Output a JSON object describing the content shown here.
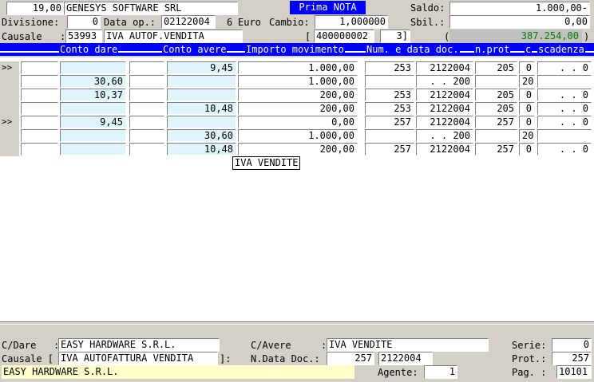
{
  "header": {
    "amount": "19,00",
    "company": "GENESYS SOFTWARE SRL",
    "title": "Prima NOTA",
    "saldo_label": "Saldo:",
    "saldo_value": "1.000,00-",
    "sbil_label": "Sbil.:",
    "sbil_value": "0,00",
    "divisione_label": "Divisione:",
    "divisione_value": "0",
    "data_op_label": "Data op.:",
    "data_op_value": "02122004",
    "data_op_extra": "6",
    "euro_label": "Euro",
    "cambio_label": "Cambio:",
    "cambio_value": "1,000000",
    "causale_label": "Causale",
    "causale_code": "53993",
    "causale_desc": "IVA AUTOF.VENDITA",
    "bracket_open": "[",
    "registro_value": "400000002",
    "registro_num": "3]",
    "paren_open": "(",
    "totale_value": "387.254,00",
    "paren_close": ")"
  },
  "columns": {
    "conto_dare": "Conto dare",
    "conto_avere": "Conto avere",
    "importo": "Importo movimento",
    "num_data": "Num. e data doc.",
    "n_prot": "n.prot",
    "c": "c",
    "scadenza": "scadenza"
  },
  "rows": [
    {
      "mark": ">>",
      "dare": "",
      "avere": "9,45",
      "importo": "1.000,00",
      "num": "253",
      "data": "2122004",
      "prot": "205",
      "c": "0",
      "scad": ". . 0"
    },
    {
      "mark": "",
      "dare": "30,60",
      "avere": "",
      "importo": "1.000,00",
      "num": "",
      "data": ". . 200",
      "prot": "",
      "c": "20",
      "scad": ""
    },
    {
      "mark": "",
      "dare": "10,37",
      "avere": "",
      "importo": "200,00",
      "num": "253",
      "data": "2122004",
      "prot": "205",
      "c": "0",
      "scad": ". . 0"
    },
    {
      "mark": "",
      "dare": "",
      "avere": "10,48",
      "importo": "200,00",
      "num": "253",
      "data": "2122004",
      "prot": "205",
      "c": "0",
      "scad": ". . 0"
    },
    {
      "mark": ">>",
      "dare": "9,45",
      "avere": "",
      "importo": "0,00",
      "num": "257",
      "data": "2122004",
      "prot": "257",
      "c": "0",
      "scad": ". . 0"
    },
    {
      "mark": "",
      "dare": "",
      "avere": "30,60",
      "importo": "1.000,00",
      "num": "",
      "data": ". . 200",
      "prot": "",
      "c": "20",
      "scad": ""
    },
    {
      "mark": "",
      "dare": "",
      "avere": "10,48",
      "importo": "200,00",
      "num": "257",
      "data": "2122004",
      "prot": "257",
      "c": "0",
      "scad": ". . 0"
    }
  ],
  "tooltip": "IVA VENDITE",
  "footer": {
    "cdare_label": "C/Dare",
    "cdare_value": "EASY HARDWARE S.R.L.",
    "cavere_label": "C/Avere",
    "cavere_value": "IVA VENDITE",
    "serie_label": "Serie:",
    "serie_value": "0",
    "causale_label": "Causale [",
    "causale_value": "IVA AUTOFATTURA VENDITA",
    "causale_close": "]:",
    "ndata_label": "N.Data Doc.:",
    "ndata_num": "257",
    "ndata_date": "2122004",
    "prot_label": "Prot.:",
    "prot_value": "257",
    "desc_value": "EASY HARDWARE S.R.L.",
    "agente_label": "Agente:",
    "agente_value": "1",
    "pag_label": "Pag. :",
    "pag_value": "10101"
  },
  "colors": {
    "header_bar": "#0000ff",
    "cyan_cell": "#dff4fb",
    "desc_highlight": "#ffffcc",
    "totale_text": "#008000",
    "totale_bg": "#c0c0c0"
  }
}
